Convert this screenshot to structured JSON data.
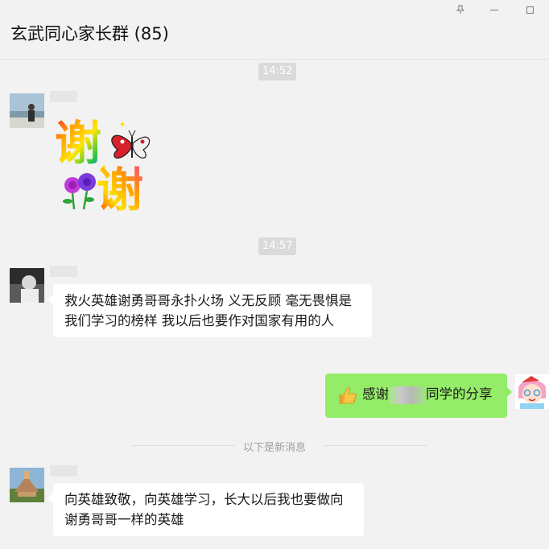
{
  "window": {
    "title": "玄武同心家长群 (85)",
    "controls": [
      "pin-icon",
      "minimize-icon",
      "maximize-icon"
    ]
  },
  "timestamps": [
    "14:52",
    "14:57"
  ],
  "messages": [
    {
      "side": "left",
      "type": "sticker",
      "sticker": {
        "chars": [
          "谢",
          "谢"
        ],
        "decor": [
          "butterfly",
          "roses"
        ]
      }
    },
    {
      "side": "left",
      "type": "text",
      "text": "救火英雄谢勇哥哥永扑火场 义无反顾 毫无畏惧是我们学习的榜样 我以后也要作对国家有用的人"
    },
    {
      "side": "right",
      "type": "text",
      "emoji": "thumbs-up",
      "text_before": "感谢",
      "text_after": "同学的分享"
    },
    {
      "side": "left",
      "type": "text",
      "text": "向英雄致敬，向英雄学习，长大以后我也要做向谢勇哥哥一样的英雄"
    }
  ],
  "divider": {
    "label": "以下是新消息"
  },
  "colors": {
    "background": "#f2f2f2",
    "bubble_left": "#ffffff",
    "bubble_right": "#95ec69",
    "time_badge": "#dadada"
  }
}
